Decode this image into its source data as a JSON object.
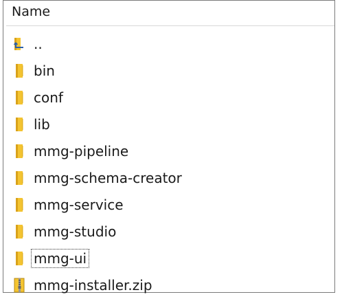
{
  "column_header": "Name",
  "items": [
    {
      "label": "..",
      "icon": "parent-folder-icon"
    },
    {
      "label": "bin",
      "icon": "folder-icon"
    },
    {
      "label": "conf",
      "icon": "folder-icon"
    },
    {
      "label": "lib",
      "icon": "folder-icon"
    },
    {
      "label": "mmg-pipeline",
      "icon": "folder-icon"
    },
    {
      "label": "mmg-schema-creator",
      "icon": "folder-icon"
    },
    {
      "label": "mmg-service",
      "icon": "folder-icon"
    },
    {
      "label": "mmg-studio",
      "icon": "folder-icon"
    },
    {
      "label": "mmg-ui",
      "icon": "folder-icon",
      "focused": true
    },
    {
      "label": "mmg-installer.zip",
      "icon": "zip-file-icon"
    }
  ],
  "colors": {
    "folder_yellow": "#f4c431",
    "folder_dark": "#d9a21b",
    "text": "#1a1a1a",
    "border": "#7a7a7a"
  }
}
